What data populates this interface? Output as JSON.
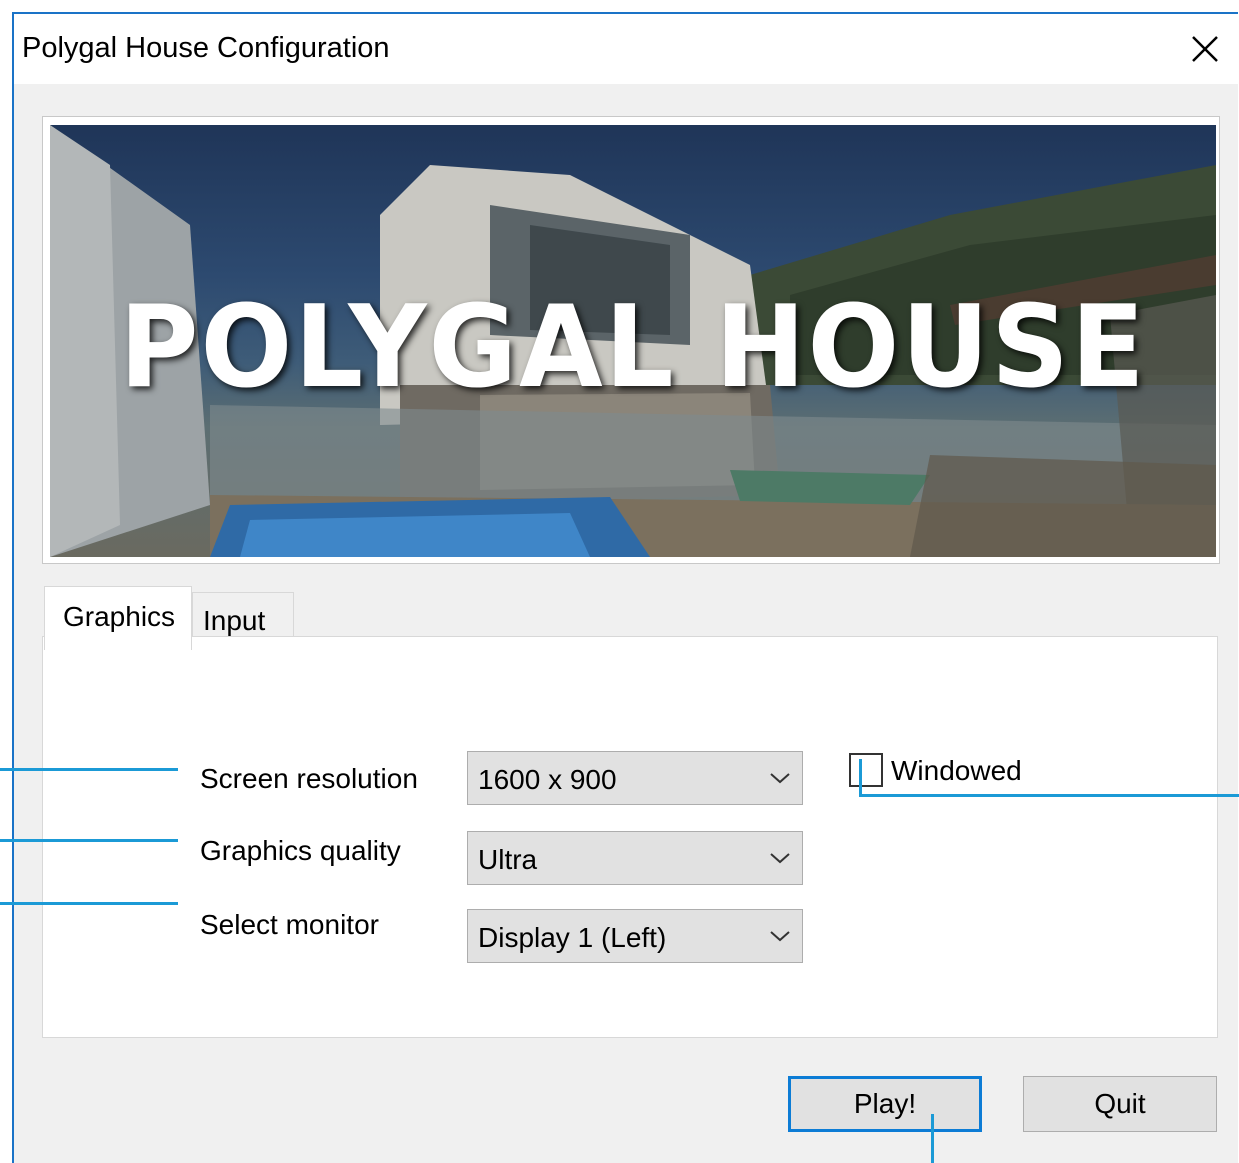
{
  "window": {
    "title": "Polygal House Configuration",
    "close_icon": "close-icon"
  },
  "banner": {
    "title": "POLYGAL HOUSE"
  },
  "tabs": [
    {
      "label": "Graphics",
      "active": true
    },
    {
      "label": "Input",
      "active": false
    }
  ],
  "graphics": {
    "resolution": {
      "label": "Screen resolution",
      "value": "1600 x 900"
    },
    "quality": {
      "label": "Graphics quality",
      "value": "Ultra"
    },
    "monitor": {
      "label": "Select monitor",
      "value": "Display 1 (Left)"
    },
    "windowed": {
      "label": "Windowed",
      "checked": false
    }
  },
  "buttons": {
    "play": "Play!",
    "quit": "Quit"
  },
  "colors": {
    "accent": "#0c7cd5",
    "annotation": "#1b9ad6",
    "window_border": "#1a73c7"
  }
}
